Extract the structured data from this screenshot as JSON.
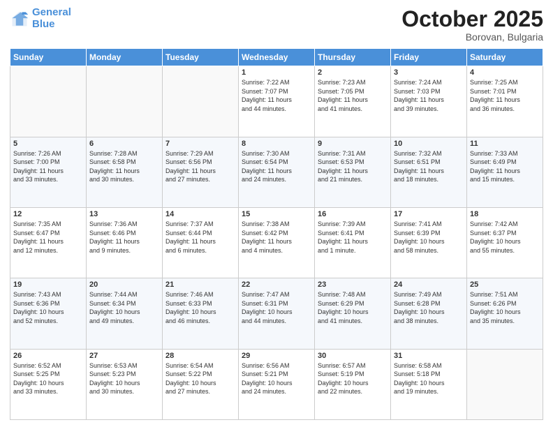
{
  "header": {
    "logo_line1": "General",
    "logo_line2": "Blue",
    "month": "October 2025",
    "location": "Borovan, Bulgaria"
  },
  "days_of_week": [
    "Sunday",
    "Monday",
    "Tuesday",
    "Wednesday",
    "Thursday",
    "Friday",
    "Saturday"
  ],
  "weeks": [
    [
      {
        "num": "",
        "info": ""
      },
      {
        "num": "",
        "info": ""
      },
      {
        "num": "",
        "info": ""
      },
      {
        "num": "1",
        "info": "Sunrise: 7:22 AM\nSunset: 7:07 PM\nDaylight: 11 hours\nand 44 minutes."
      },
      {
        "num": "2",
        "info": "Sunrise: 7:23 AM\nSunset: 7:05 PM\nDaylight: 11 hours\nand 41 minutes."
      },
      {
        "num": "3",
        "info": "Sunrise: 7:24 AM\nSunset: 7:03 PM\nDaylight: 11 hours\nand 39 minutes."
      },
      {
        "num": "4",
        "info": "Sunrise: 7:25 AM\nSunset: 7:01 PM\nDaylight: 11 hours\nand 36 minutes."
      }
    ],
    [
      {
        "num": "5",
        "info": "Sunrise: 7:26 AM\nSunset: 7:00 PM\nDaylight: 11 hours\nand 33 minutes."
      },
      {
        "num": "6",
        "info": "Sunrise: 7:28 AM\nSunset: 6:58 PM\nDaylight: 11 hours\nand 30 minutes."
      },
      {
        "num": "7",
        "info": "Sunrise: 7:29 AM\nSunset: 6:56 PM\nDaylight: 11 hours\nand 27 minutes."
      },
      {
        "num": "8",
        "info": "Sunrise: 7:30 AM\nSunset: 6:54 PM\nDaylight: 11 hours\nand 24 minutes."
      },
      {
        "num": "9",
        "info": "Sunrise: 7:31 AM\nSunset: 6:53 PM\nDaylight: 11 hours\nand 21 minutes."
      },
      {
        "num": "10",
        "info": "Sunrise: 7:32 AM\nSunset: 6:51 PM\nDaylight: 11 hours\nand 18 minutes."
      },
      {
        "num": "11",
        "info": "Sunrise: 7:33 AM\nSunset: 6:49 PM\nDaylight: 11 hours\nand 15 minutes."
      }
    ],
    [
      {
        "num": "12",
        "info": "Sunrise: 7:35 AM\nSunset: 6:47 PM\nDaylight: 11 hours\nand 12 minutes."
      },
      {
        "num": "13",
        "info": "Sunrise: 7:36 AM\nSunset: 6:46 PM\nDaylight: 11 hours\nand 9 minutes."
      },
      {
        "num": "14",
        "info": "Sunrise: 7:37 AM\nSunset: 6:44 PM\nDaylight: 11 hours\nand 6 minutes."
      },
      {
        "num": "15",
        "info": "Sunrise: 7:38 AM\nSunset: 6:42 PM\nDaylight: 11 hours\nand 4 minutes."
      },
      {
        "num": "16",
        "info": "Sunrise: 7:39 AM\nSunset: 6:41 PM\nDaylight: 11 hours\nand 1 minute."
      },
      {
        "num": "17",
        "info": "Sunrise: 7:41 AM\nSunset: 6:39 PM\nDaylight: 10 hours\nand 58 minutes."
      },
      {
        "num": "18",
        "info": "Sunrise: 7:42 AM\nSunset: 6:37 PM\nDaylight: 10 hours\nand 55 minutes."
      }
    ],
    [
      {
        "num": "19",
        "info": "Sunrise: 7:43 AM\nSunset: 6:36 PM\nDaylight: 10 hours\nand 52 minutes."
      },
      {
        "num": "20",
        "info": "Sunrise: 7:44 AM\nSunset: 6:34 PM\nDaylight: 10 hours\nand 49 minutes."
      },
      {
        "num": "21",
        "info": "Sunrise: 7:46 AM\nSunset: 6:33 PM\nDaylight: 10 hours\nand 46 minutes."
      },
      {
        "num": "22",
        "info": "Sunrise: 7:47 AM\nSunset: 6:31 PM\nDaylight: 10 hours\nand 44 minutes."
      },
      {
        "num": "23",
        "info": "Sunrise: 7:48 AM\nSunset: 6:29 PM\nDaylight: 10 hours\nand 41 minutes."
      },
      {
        "num": "24",
        "info": "Sunrise: 7:49 AM\nSunset: 6:28 PM\nDaylight: 10 hours\nand 38 minutes."
      },
      {
        "num": "25",
        "info": "Sunrise: 7:51 AM\nSunset: 6:26 PM\nDaylight: 10 hours\nand 35 minutes."
      }
    ],
    [
      {
        "num": "26",
        "info": "Sunrise: 6:52 AM\nSunset: 5:25 PM\nDaylight: 10 hours\nand 33 minutes."
      },
      {
        "num": "27",
        "info": "Sunrise: 6:53 AM\nSunset: 5:23 PM\nDaylight: 10 hours\nand 30 minutes."
      },
      {
        "num": "28",
        "info": "Sunrise: 6:54 AM\nSunset: 5:22 PM\nDaylight: 10 hours\nand 27 minutes."
      },
      {
        "num": "29",
        "info": "Sunrise: 6:56 AM\nSunset: 5:21 PM\nDaylight: 10 hours\nand 24 minutes."
      },
      {
        "num": "30",
        "info": "Sunrise: 6:57 AM\nSunset: 5:19 PM\nDaylight: 10 hours\nand 22 minutes."
      },
      {
        "num": "31",
        "info": "Sunrise: 6:58 AM\nSunset: 5:18 PM\nDaylight: 10 hours\nand 19 minutes."
      },
      {
        "num": "",
        "info": ""
      }
    ]
  ]
}
